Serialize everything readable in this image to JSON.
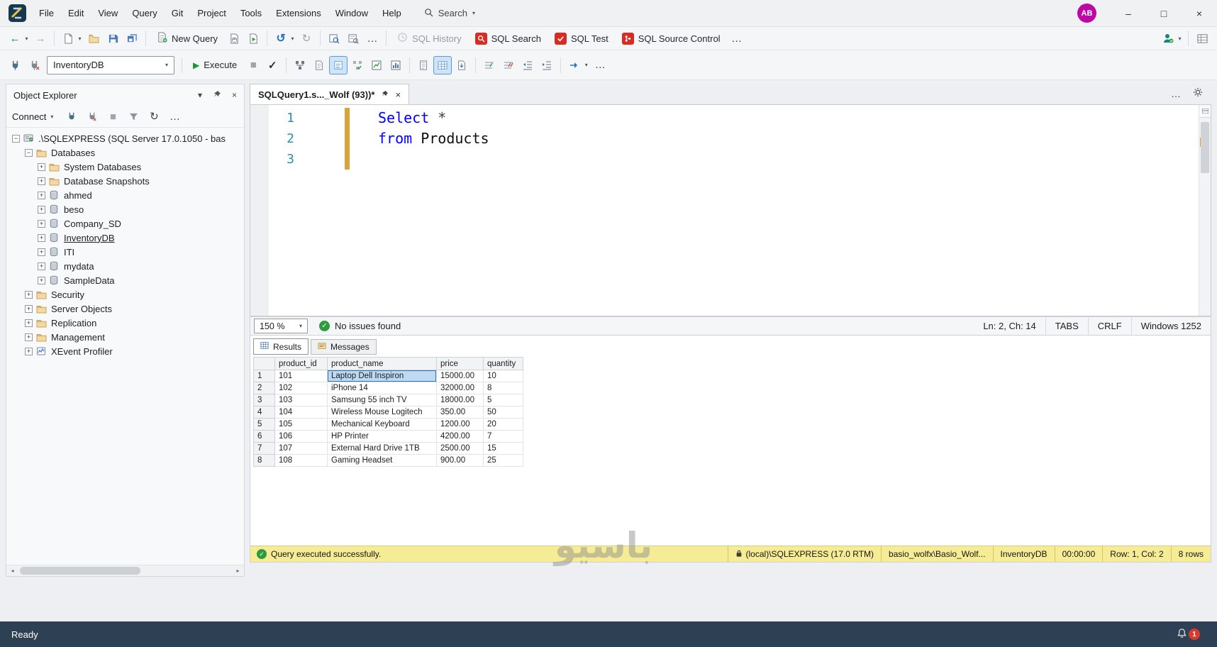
{
  "icons": {
    "nav_back": "←",
    "nav_forward": "→",
    "chevron_small": "▾",
    "more": "…",
    "close": "×",
    "minimize": "–",
    "maximize": "□",
    "undo": "↺",
    "redo": "↻",
    "refresh": "↻",
    "stop_square": "■",
    "check": "✓",
    "play": "▶",
    "scroll_left": "◂",
    "scroll_right": "▸",
    "expand_plus": "+",
    "collapse_minus": "−",
    "split_box": "▭"
  },
  "titlebar": {
    "menus": [
      "File",
      "Edit",
      "View",
      "Query",
      "Git",
      "Project",
      "Tools",
      "Extensions",
      "Window",
      "Help"
    ],
    "search_label": "Search",
    "avatar_initials": "AB"
  },
  "toolbar_top": {
    "new_query_label": "New Query",
    "sql_history_label": "SQL History",
    "sql_search_label": "SQL Search",
    "sql_test_label": "SQL Test",
    "sql_source_control_label": "SQL Source Control"
  },
  "toolbar_query": {
    "database_selected": "InventoryDB",
    "execute_label": "Execute"
  },
  "object_explorer": {
    "title": "Object Explorer",
    "connect_label": "Connect",
    "tree": [
      {
        "id": "server",
        "label": ".\\SQLEXPRESS (SQL Server 17.0.1050 - bas",
        "level": 0,
        "icon": "server",
        "expand": "minus"
      },
      {
        "id": "databases",
        "label": "Databases",
        "level": 1,
        "icon": "folder",
        "expand": "minus"
      },
      {
        "id": "system-databases",
        "label": "System Databases",
        "level": 2,
        "icon": "folder",
        "expand": "plus"
      },
      {
        "id": "database-snapshots",
        "label": "Database Snapshots",
        "level": 2,
        "icon": "folder",
        "expand": "plus"
      },
      {
        "id": "ahmed",
        "label": "ahmed",
        "level": 2,
        "icon": "db",
        "expand": "plus"
      },
      {
        "id": "beso",
        "label": "beso",
        "level": 2,
        "icon": "db",
        "expand": "plus"
      },
      {
        "id": "company-sd",
        "label": "Company_SD",
        "level": 2,
        "icon": "db",
        "expand": "plus"
      },
      {
        "id": "inventorydb",
        "label": "InventoryDB",
        "level": 2,
        "icon": "db",
        "expand": "plus",
        "selected": true
      },
      {
        "id": "iti",
        "label": "ITI",
        "level": 2,
        "icon": "db",
        "expand": "plus"
      },
      {
        "id": "mydata",
        "label": "mydata",
        "level": 2,
        "icon": "db",
        "expand": "plus"
      },
      {
        "id": "sampledata",
        "label": "SampleData",
        "level": 2,
        "icon": "db",
        "expand": "plus"
      },
      {
        "id": "security",
        "label": "Security",
        "level": 1,
        "icon": "folder",
        "expand": "plus"
      },
      {
        "id": "server-objects",
        "label": "Server Objects",
        "level": 1,
        "icon": "folder",
        "expand": "plus"
      },
      {
        "id": "replication",
        "label": "Replication",
        "level": 1,
        "icon": "folder",
        "expand": "plus"
      },
      {
        "id": "management",
        "label": "Management",
        "level": 1,
        "icon": "folder",
        "expand": "plus"
      },
      {
        "id": "xevent-profiler",
        "label": "XEvent Profiler",
        "level": 1,
        "icon": "xevent",
        "expand": "plus"
      }
    ]
  },
  "editor": {
    "tab_title": "SQLQuery1.s..._Wolf (93))*",
    "lines": [
      {
        "number": "1",
        "tokens": [
          {
            "text": "Select",
            "type": "keyword"
          },
          {
            "text": " *",
            "type": "operator"
          }
        ]
      },
      {
        "number": "2",
        "tokens": [
          {
            "text": "from",
            "type": "keyword"
          },
          {
            "text": " Products",
            "type": "plain"
          }
        ]
      },
      {
        "number": "3",
        "tokens": []
      }
    ],
    "zoom_level": "150 %",
    "issues_status": "No issues found",
    "caret_position": "Ln: 2, Ch: 14",
    "indent_mode": "TABS",
    "line_endings": "CRLF",
    "encoding": "Windows 1252"
  },
  "results": {
    "tab_results": "Results",
    "tab_messages": "Messages",
    "grid": {
      "columns": [
        "product_id",
        "product_name",
        "price",
        "quantity"
      ],
      "rows": [
        [
          "101",
          "Laptop Dell Inspiron",
          "15000.00",
          "10"
        ],
        [
          "102",
          "iPhone 14",
          "32000.00",
          "8"
        ],
        [
          "103",
          "Samsung 55 inch TV",
          "18000.00",
          "5"
        ],
        [
          "104",
          "Wireless Mouse Logitech",
          "350.00",
          "50"
        ],
        [
          "105",
          "Mechanical Keyboard",
          "1200.00",
          "20"
        ],
        [
          "106",
          "HP Printer",
          "4200.00",
          "7"
        ],
        [
          "107",
          "External Hard Drive 1TB",
          "2500.00",
          "15"
        ],
        [
          "108",
          "Gaming Headset",
          "900.00",
          "25"
        ]
      ],
      "selected_cell": {
        "row": 0,
        "column": 1
      }
    }
  },
  "query_statusbar": {
    "message": "Query executed successfully.",
    "segments": [
      {
        "icon": "lock",
        "text": "(local)\\SQLEXPRESS (17.0 RTM)"
      },
      {
        "text": "basio_wolfx\\Basio_Wolf..."
      },
      {
        "text": "InventoryDB"
      },
      {
        "text": "00:00:00"
      },
      {
        "text": "Row: 1, Col: 2"
      },
      {
        "text": "8 rows"
      }
    ]
  },
  "app_statusbar": {
    "status": "Ready",
    "notification_count": "1"
  },
  "watermark": "باسيو",
  "colors": {
    "keyword_blue": "#0000ff",
    "line_number_teal": "#2b91af",
    "success_green": "#2e9b3f",
    "redgate_red": "#d92b21",
    "status_yellow": "#f5ec95",
    "statusbar_dark": "#2e4053",
    "selection_blue": "#bed9f2",
    "avatar_magenta": "#bd08a6"
  }
}
